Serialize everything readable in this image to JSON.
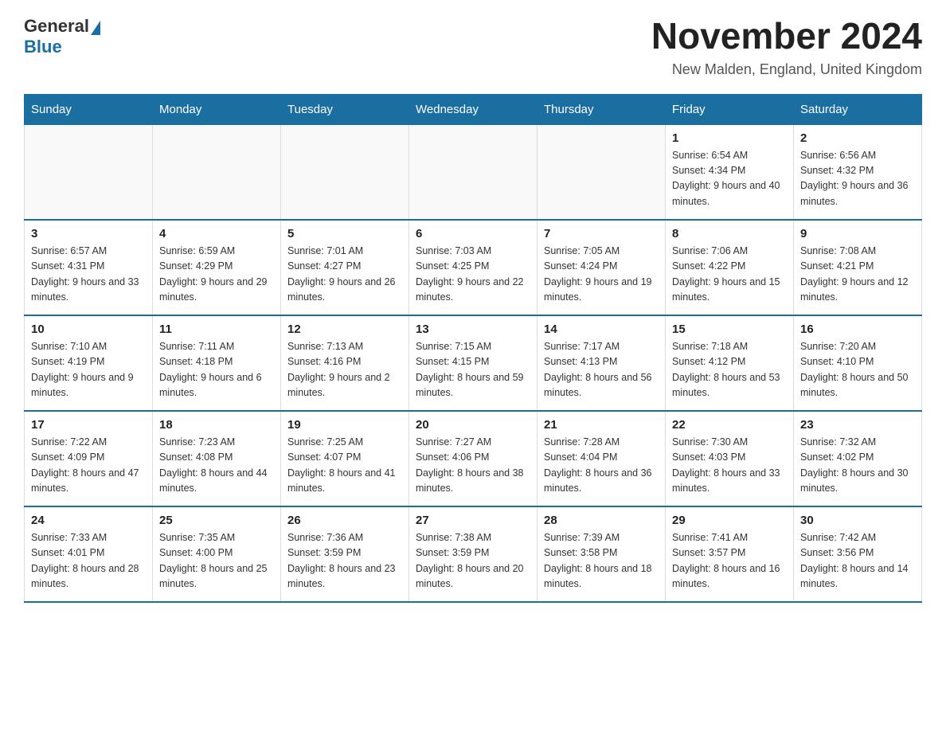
{
  "header": {
    "logo_general": "General",
    "logo_blue": "Blue",
    "title": "November 2024",
    "subtitle": "New Malden, England, United Kingdom"
  },
  "days_of_week": [
    "Sunday",
    "Monday",
    "Tuesday",
    "Wednesday",
    "Thursday",
    "Friday",
    "Saturday"
  ],
  "weeks": [
    [
      {
        "num": "",
        "sunrise": "",
        "sunset": "",
        "daylight": ""
      },
      {
        "num": "",
        "sunrise": "",
        "sunset": "",
        "daylight": ""
      },
      {
        "num": "",
        "sunrise": "",
        "sunset": "",
        "daylight": ""
      },
      {
        "num": "",
        "sunrise": "",
        "sunset": "",
        "daylight": ""
      },
      {
        "num": "",
        "sunrise": "",
        "sunset": "",
        "daylight": ""
      },
      {
        "num": "1",
        "sunrise": "Sunrise: 6:54 AM",
        "sunset": "Sunset: 4:34 PM",
        "daylight": "Daylight: 9 hours and 40 minutes."
      },
      {
        "num": "2",
        "sunrise": "Sunrise: 6:56 AM",
        "sunset": "Sunset: 4:32 PM",
        "daylight": "Daylight: 9 hours and 36 minutes."
      }
    ],
    [
      {
        "num": "3",
        "sunrise": "Sunrise: 6:57 AM",
        "sunset": "Sunset: 4:31 PM",
        "daylight": "Daylight: 9 hours and 33 minutes."
      },
      {
        "num": "4",
        "sunrise": "Sunrise: 6:59 AM",
        "sunset": "Sunset: 4:29 PM",
        "daylight": "Daylight: 9 hours and 29 minutes."
      },
      {
        "num": "5",
        "sunrise": "Sunrise: 7:01 AM",
        "sunset": "Sunset: 4:27 PM",
        "daylight": "Daylight: 9 hours and 26 minutes."
      },
      {
        "num": "6",
        "sunrise": "Sunrise: 7:03 AM",
        "sunset": "Sunset: 4:25 PM",
        "daylight": "Daylight: 9 hours and 22 minutes."
      },
      {
        "num": "7",
        "sunrise": "Sunrise: 7:05 AM",
        "sunset": "Sunset: 4:24 PM",
        "daylight": "Daylight: 9 hours and 19 minutes."
      },
      {
        "num": "8",
        "sunrise": "Sunrise: 7:06 AM",
        "sunset": "Sunset: 4:22 PM",
        "daylight": "Daylight: 9 hours and 15 minutes."
      },
      {
        "num": "9",
        "sunrise": "Sunrise: 7:08 AM",
        "sunset": "Sunset: 4:21 PM",
        "daylight": "Daylight: 9 hours and 12 minutes."
      }
    ],
    [
      {
        "num": "10",
        "sunrise": "Sunrise: 7:10 AM",
        "sunset": "Sunset: 4:19 PM",
        "daylight": "Daylight: 9 hours and 9 minutes."
      },
      {
        "num": "11",
        "sunrise": "Sunrise: 7:11 AM",
        "sunset": "Sunset: 4:18 PM",
        "daylight": "Daylight: 9 hours and 6 minutes."
      },
      {
        "num": "12",
        "sunrise": "Sunrise: 7:13 AM",
        "sunset": "Sunset: 4:16 PM",
        "daylight": "Daylight: 9 hours and 2 minutes."
      },
      {
        "num": "13",
        "sunrise": "Sunrise: 7:15 AM",
        "sunset": "Sunset: 4:15 PM",
        "daylight": "Daylight: 8 hours and 59 minutes."
      },
      {
        "num": "14",
        "sunrise": "Sunrise: 7:17 AM",
        "sunset": "Sunset: 4:13 PM",
        "daylight": "Daylight: 8 hours and 56 minutes."
      },
      {
        "num": "15",
        "sunrise": "Sunrise: 7:18 AM",
        "sunset": "Sunset: 4:12 PM",
        "daylight": "Daylight: 8 hours and 53 minutes."
      },
      {
        "num": "16",
        "sunrise": "Sunrise: 7:20 AM",
        "sunset": "Sunset: 4:10 PM",
        "daylight": "Daylight: 8 hours and 50 minutes."
      }
    ],
    [
      {
        "num": "17",
        "sunrise": "Sunrise: 7:22 AM",
        "sunset": "Sunset: 4:09 PM",
        "daylight": "Daylight: 8 hours and 47 minutes."
      },
      {
        "num": "18",
        "sunrise": "Sunrise: 7:23 AM",
        "sunset": "Sunset: 4:08 PM",
        "daylight": "Daylight: 8 hours and 44 minutes."
      },
      {
        "num": "19",
        "sunrise": "Sunrise: 7:25 AM",
        "sunset": "Sunset: 4:07 PM",
        "daylight": "Daylight: 8 hours and 41 minutes."
      },
      {
        "num": "20",
        "sunrise": "Sunrise: 7:27 AM",
        "sunset": "Sunset: 4:06 PM",
        "daylight": "Daylight: 8 hours and 38 minutes."
      },
      {
        "num": "21",
        "sunrise": "Sunrise: 7:28 AM",
        "sunset": "Sunset: 4:04 PM",
        "daylight": "Daylight: 8 hours and 36 minutes."
      },
      {
        "num": "22",
        "sunrise": "Sunrise: 7:30 AM",
        "sunset": "Sunset: 4:03 PM",
        "daylight": "Daylight: 8 hours and 33 minutes."
      },
      {
        "num": "23",
        "sunrise": "Sunrise: 7:32 AM",
        "sunset": "Sunset: 4:02 PM",
        "daylight": "Daylight: 8 hours and 30 minutes."
      }
    ],
    [
      {
        "num": "24",
        "sunrise": "Sunrise: 7:33 AM",
        "sunset": "Sunset: 4:01 PM",
        "daylight": "Daylight: 8 hours and 28 minutes."
      },
      {
        "num": "25",
        "sunrise": "Sunrise: 7:35 AM",
        "sunset": "Sunset: 4:00 PM",
        "daylight": "Daylight: 8 hours and 25 minutes."
      },
      {
        "num": "26",
        "sunrise": "Sunrise: 7:36 AM",
        "sunset": "Sunset: 3:59 PM",
        "daylight": "Daylight: 8 hours and 23 minutes."
      },
      {
        "num": "27",
        "sunrise": "Sunrise: 7:38 AM",
        "sunset": "Sunset: 3:59 PM",
        "daylight": "Daylight: 8 hours and 20 minutes."
      },
      {
        "num": "28",
        "sunrise": "Sunrise: 7:39 AM",
        "sunset": "Sunset: 3:58 PM",
        "daylight": "Daylight: 8 hours and 18 minutes."
      },
      {
        "num": "29",
        "sunrise": "Sunrise: 7:41 AM",
        "sunset": "Sunset: 3:57 PM",
        "daylight": "Daylight: 8 hours and 16 minutes."
      },
      {
        "num": "30",
        "sunrise": "Sunrise: 7:42 AM",
        "sunset": "Sunset: 3:56 PM",
        "daylight": "Daylight: 8 hours and 14 minutes."
      }
    ]
  ]
}
